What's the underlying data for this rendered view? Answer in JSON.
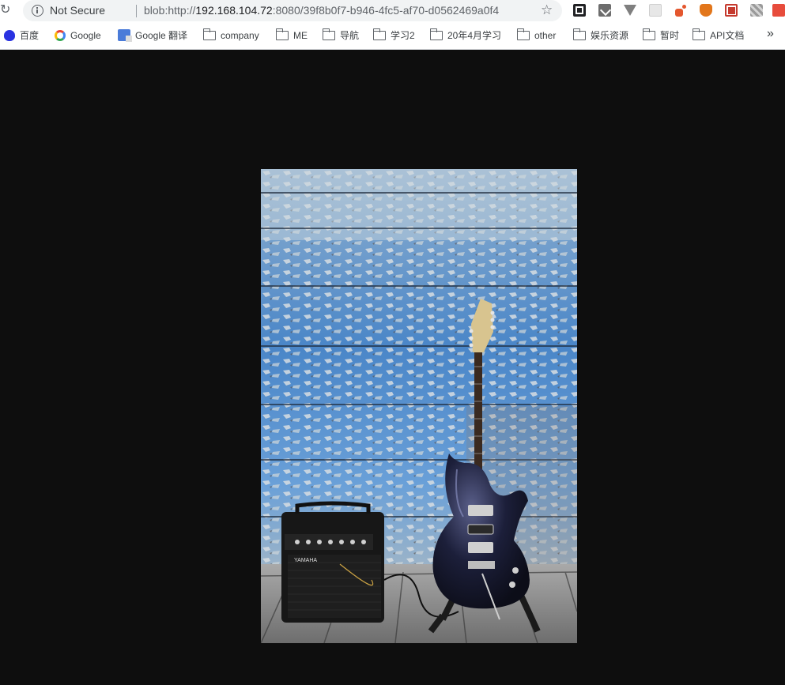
{
  "toolbar": {
    "security_label": "Not Secure",
    "url_prefix": "blob:http://",
    "url_host": "192.168.104.72",
    "url_rest": ":8080/39f8b0f7-b946-4fc5-af70-d0562469a0f4"
  },
  "icons": {
    "reload": "reload-icon",
    "info": "info-icon",
    "star": "bookmark-star-icon",
    "overflow": "chevron-double-right-icon"
  },
  "bookmarks": [
    {
      "label": "百度",
      "icon": "baidu-icon"
    },
    {
      "label": "Google",
      "icon": "google-icon"
    },
    {
      "label": "Google 翻译",
      "icon": "google-translate-icon"
    },
    {
      "label": "company",
      "icon": "folder-icon"
    },
    {
      "label": "ME",
      "icon": "folder-icon"
    },
    {
      "label": "导航",
      "icon": "folder-icon"
    },
    {
      "label": "学习2",
      "icon": "folder-icon"
    },
    {
      "label": "20年4月学习",
      "icon": "folder-icon"
    },
    {
      "label": "other",
      "icon": "folder-icon"
    },
    {
      "label": "娱乐资源",
      "icon": "folder-icon"
    },
    {
      "label": "暂时",
      "icon": "folder-icon"
    },
    {
      "label": "API文档",
      "icon": "folder-icon"
    }
  ],
  "extensions": [
    "qr-code-icon",
    "download-icon",
    "vue-devtools-icon",
    "extension-icon",
    "extension-icon",
    "metamask-icon",
    "fe-helper-icon",
    "extension-icon",
    "extension-icon"
  ],
  "image": {
    "alt": "Electric guitar and YAMAHA amplifier in front of a peeling blue wooden wall",
    "amp_brand": "YAMAHA"
  },
  "colors": {
    "page_background": "#0e0e0e",
    "wall_blue": "#4a86c8",
    "guitar_body": "#1c1f3a"
  }
}
